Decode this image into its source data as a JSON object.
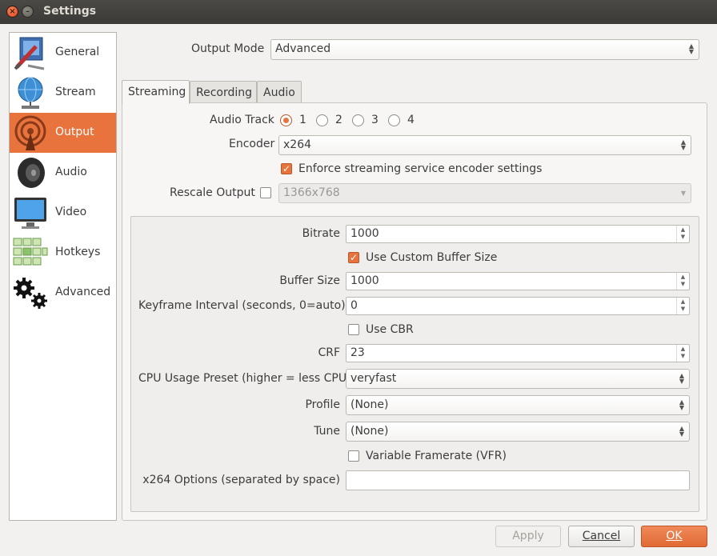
{
  "window": {
    "title": "Settings"
  },
  "sidebar": {
    "items": [
      {
        "label": "General",
        "icon": "general-icon"
      },
      {
        "label": "Stream",
        "icon": "stream-globe-icon"
      },
      {
        "label": "Output",
        "icon": "output-broadcast-icon",
        "selected": true
      },
      {
        "label": "Audio",
        "icon": "speaker-icon"
      },
      {
        "label": "Video",
        "icon": "monitor-icon"
      },
      {
        "label": "Hotkeys",
        "icon": "keyboard-icon"
      },
      {
        "label": "Advanced",
        "icon": "gears-icon"
      }
    ]
  },
  "output_mode": {
    "label": "Output Mode",
    "value": "Advanced"
  },
  "tabs": [
    {
      "label": "Streaming",
      "active": true
    },
    {
      "label": "Recording",
      "active": false
    },
    {
      "label": "Audio",
      "active": false
    }
  ],
  "streaming": {
    "audio_track": {
      "label": "Audio Track",
      "options": [
        "1",
        "2",
        "3",
        "4"
      ],
      "selected": "1"
    },
    "encoder": {
      "label": "Encoder",
      "value": "x264"
    },
    "enforce": {
      "label": "Enforce streaming service encoder settings",
      "checked": true
    },
    "rescale": {
      "label": "Rescale Output",
      "checked": false,
      "value": "1366x768"
    },
    "bitrate": {
      "label": "Bitrate",
      "value": "1000"
    },
    "custom_buffer": {
      "label": "Use Custom Buffer Size",
      "checked": true
    },
    "buffer_size": {
      "label": "Buffer Size",
      "value": "1000"
    },
    "keyframe": {
      "label": "Keyframe Interval (seconds, 0=auto)",
      "value": "0"
    },
    "use_cbr": {
      "label": "Use CBR",
      "checked": false
    },
    "crf": {
      "label": "CRF",
      "value": "23"
    },
    "cpu_preset": {
      "label": "CPU Usage Preset (higher = less CPU)",
      "value": "veryfast"
    },
    "profile": {
      "label": "Profile",
      "value": "(None)"
    },
    "tune": {
      "label": "Tune",
      "value": "(None)"
    },
    "vfr": {
      "label": "Variable Framerate (VFR)",
      "checked": false
    },
    "x264_options": {
      "label": "x264 Options (separated by space)",
      "value": ""
    }
  },
  "buttons": {
    "apply": "Apply",
    "cancel": "Cancel",
    "ok": "OK"
  },
  "colors": {
    "accent": "#e8733d",
    "titlebar": "#3c3b37"
  }
}
